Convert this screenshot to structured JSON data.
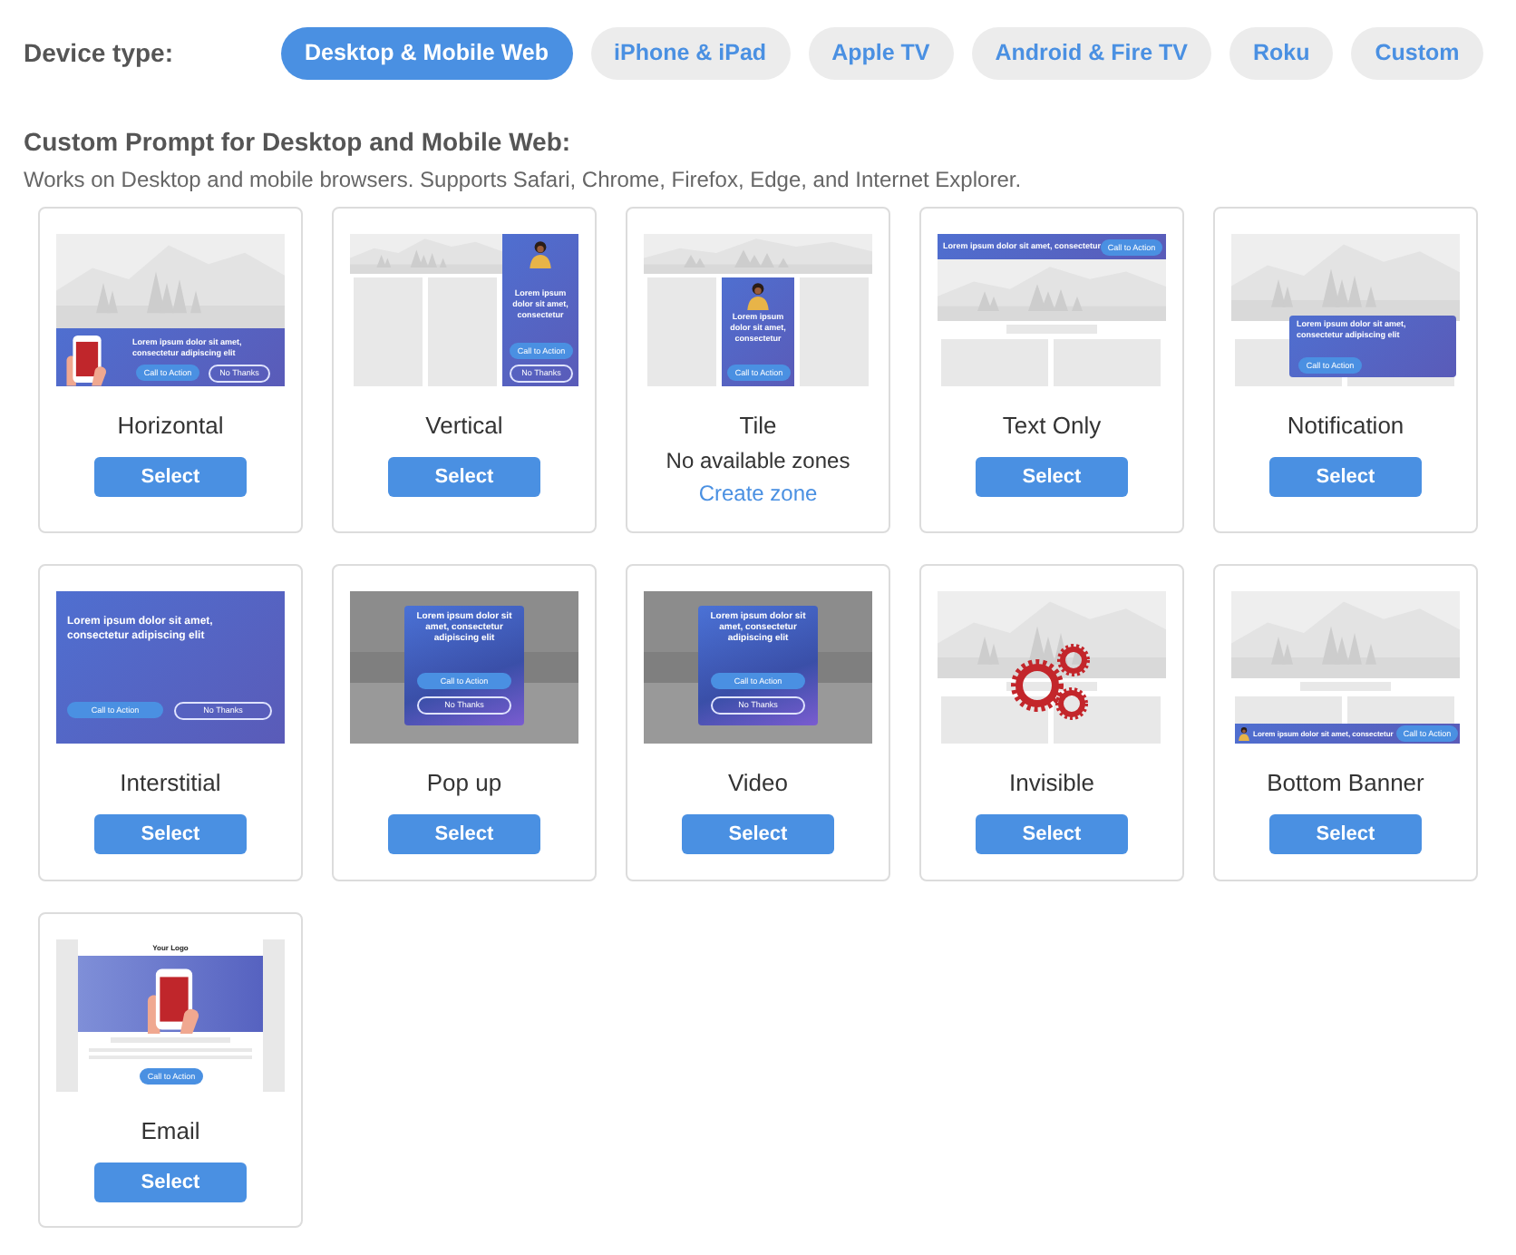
{
  "device_type": {
    "label": "Device type:",
    "tabs": [
      {
        "label": "Desktop & Mobile Web",
        "selected": true
      },
      {
        "label": "iPhone & iPad",
        "selected": false
      },
      {
        "label": "Apple TV",
        "selected": false
      },
      {
        "label": "Android & Fire TV",
        "selected": false
      },
      {
        "label": "Roku",
        "selected": false
      },
      {
        "label": "Custom",
        "selected": false
      }
    ]
  },
  "section": {
    "title": "Custom Prompt for Desktop and Mobile Web:",
    "description": "Works on Desktop and mobile browsers. Supports Safari, Chrome, Firefox, Edge, and Internet Explorer."
  },
  "templates": [
    {
      "name": "Horizontal",
      "button": "Select",
      "preview": {
        "kind": "horizontal",
        "headline": "Lorem ipsum dolor sit amet, consectetur adipiscing elit",
        "cta": "Call to Action",
        "dismiss": "No Thanks"
      }
    },
    {
      "name": "Vertical",
      "button": "Select",
      "preview": {
        "kind": "vertical",
        "headline": "Lorem ipsum dolor sit amet, consectetur",
        "cta": "Call to Action",
        "dismiss": "No Thanks"
      }
    },
    {
      "name": "Tile",
      "status": "No available zones",
      "link": "Create zone",
      "preview": {
        "kind": "tile",
        "headline": "Lorem ipsum dolor sit amet, consectetur",
        "cta": "Call to Action"
      }
    },
    {
      "name": "Text Only",
      "button": "Select",
      "preview": {
        "kind": "text_only",
        "headline": "Lorem ipsum dolor sit amet, consectetur",
        "cta": "Call to Action"
      }
    },
    {
      "name": "Notification",
      "button": "Select",
      "preview": {
        "kind": "notification",
        "headline": "Lorem ipsum dolor sit amet, consectetur adipiscing elit",
        "cta": "Call to Action"
      }
    },
    {
      "name": "Interstitial",
      "button": "Select",
      "preview": {
        "kind": "interstitial",
        "headline": "Lorem ipsum dolor sit amet, consectetur adipiscing elit",
        "cta": "Call to Action",
        "dismiss": "No Thanks"
      }
    },
    {
      "name": "Pop up",
      "button": "Select",
      "preview": {
        "kind": "popup",
        "headline": "Lorem ipsum dolor sit amet, consectetur adipiscing elit",
        "cta": "Call to Action",
        "dismiss": "No Thanks"
      }
    },
    {
      "name": "Video",
      "button": "Select",
      "preview": {
        "kind": "popup",
        "headline": "Lorem ipsum dolor sit amet, consectetur adipiscing elit",
        "cta": "Call to Action",
        "dismiss": "No Thanks"
      }
    },
    {
      "name": "Invisible",
      "button": "Select",
      "preview": {
        "kind": "invisible"
      }
    },
    {
      "name": "Bottom Banner",
      "button": "Select",
      "preview": {
        "kind": "bottom_banner",
        "headline": "Lorem ipsum dolor sit amet, consectetur",
        "cta": "Call to Action"
      }
    },
    {
      "name": "Email",
      "button": "Select",
      "preview": {
        "kind": "email",
        "logo": "Your Logo",
        "cta": "Call to Action"
      }
    }
  ]
}
